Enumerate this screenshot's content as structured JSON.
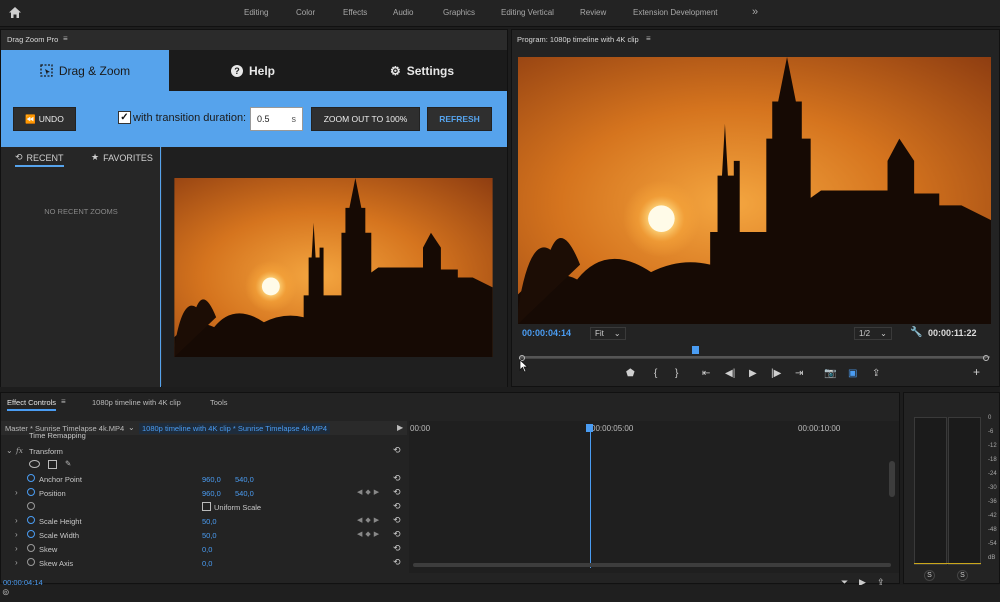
{
  "workspace_tabs": [
    "Editing",
    "Color",
    "Effects",
    "Audio",
    "Graphics",
    "Editing Vertical",
    "Review",
    "Extension Development"
  ],
  "drag_zoom": {
    "panel_title": "Drag Zoom Pro",
    "tabs": [
      {
        "label": "Drag & Zoom"
      },
      {
        "label": "Help"
      },
      {
        "label": "Settings"
      }
    ],
    "undo_label": "UNDO",
    "transition_label": "with transition duration:",
    "duration_value": "0.5",
    "duration_unit": "s",
    "zoom_out_label": "ZOOM OUT TO 100%",
    "refresh_label": "REFRESH",
    "side_tabs": [
      {
        "label": "RECENT"
      },
      {
        "label": "FAVORITES"
      }
    ],
    "empty_text": "NO RECENT ZOOMS"
  },
  "program": {
    "title": "Program: 1080p timeline with 4K clip",
    "current_time": "00:00:04:14",
    "fit": "Fit",
    "resolution": "1/2",
    "duration": "00:00:11:22"
  },
  "effect_controls": {
    "tabs": [
      "Effect Controls",
      "1080p timeline with 4K clip",
      "Tools"
    ],
    "master": "Master * Sunrise Timelapse 4k.MP4",
    "sequence_clip": "1080p timeline with 4K clip * Sunrise Timelapse 4k.MP4",
    "time_remapping": "Time Remapping",
    "fx": "fx",
    "transform": "Transform",
    "props": {
      "anchor_point": {
        "label": "Anchor Point",
        "v1": "960,0",
        "v2": "540,0"
      },
      "position": {
        "label": "Position",
        "v1": "960,0",
        "v2": "540,0"
      },
      "uniform_scale": {
        "label": "Uniform Scale"
      },
      "scale_height": {
        "label": "Scale Height",
        "v1": "50,0"
      },
      "scale_width": {
        "label": "Scale Width",
        "v1": "50,0"
      },
      "skew": {
        "label": "Skew",
        "v1": "0,0"
      },
      "skew_axis": {
        "label": "Skew Axis",
        "v1": "0,0"
      }
    },
    "ruler": [
      "00:00",
      "00:00:05:00",
      "00:00:10:00"
    ],
    "current_time": "00:00:04:14"
  },
  "meters": {
    "db_scale": [
      "0",
      "-6",
      "-12",
      "-18",
      "-24",
      "-30",
      "-36",
      "-42",
      "-48",
      "-54",
      "dB"
    ],
    "solo": [
      "S",
      "S"
    ]
  },
  "colors": {
    "accent": "#56a3ec",
    "timecode": "#4a9cf2"
  }
}
